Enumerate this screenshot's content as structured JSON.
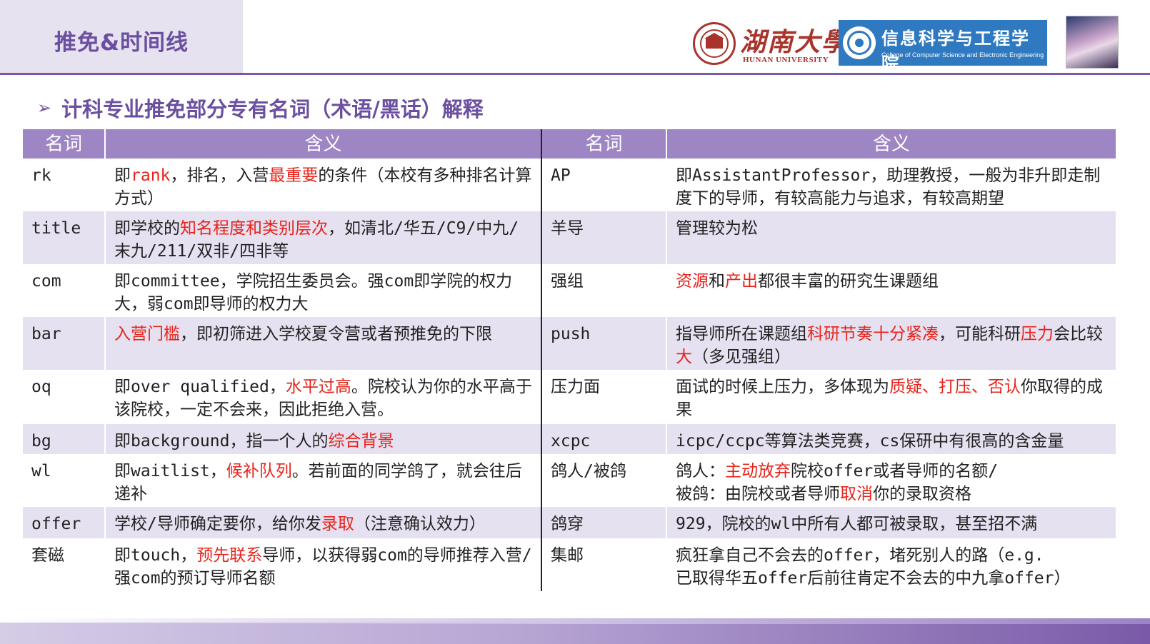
{
  "header": {
    "section_title": "推免&时间线",
    "university_cn": "湖南大學",
    "university_en": "HUNAN UNIVERSITY",
    "college_cn": "信息科学与工程学院",
    "college_en": "College of Computer Science and Electronic Engineering"
  },
  "subtitle": {
    "arrow": "➢",
    "text": "计科专业推免部分专有名词（术语/黑话）解释"
  },
  "table": {
    "headers": [
      "名词",
      "含义",
      "名词",
      "含义"
    ],
    "rows": [
      {
        "term_left": "rk",
        "left_parts": [
          {
            "t": "即",
            "red": false
          },
          {
            "t": "rank",
            "red": true
          },
          {
            "t": "，排名，入营",
            "red": false
          },
          {
            "t": "最重要",
            "red": true
          },
          {
            "t": "的条件（本校有多种排名计算方式）",
            "red": false
          }
        ],
        "term_right": "AP",
        "right_parts": [
          {
            "t": "即AssistantProfessor，助理教授，一般为非升即走制度下的导师，有较高能力与追求，有较高期望",
            "red": false
          }
        ]
      },
      {
        "term_left": "title",
        "left_parts": [
          {
            "t": "即学校的",
            "red": false
          },
          {
            "t": "知名程度和类别层次",
            "red": true
          },
          {
            "t": "，如清北/华五/C9/中九/末九/211/双非/四非等",
            "red": false
          }
        ],
        "term_right": "羊导",
        "right_parts": [
          {
            "t": "管理较为松",
            "red": false
          }
        ]
      },
      {
        "term_left": "com",
        "left_parts": [
          {
            "t": "即committee，学院招生委员会。强com即学院的权力大，弱com即导师的权力大",
            "red": false
          }
        ],
        "term_right": "强组",
        "right_parts": [
          {
            "t": "资源",
            "red": true
          },
          {
            "t": "和",
            "red": false
          },
          {
            "t": "产出",
            "red": true
          },
          {
            "t": "都很丰富的研究生课题组",
            "red": false
          }
        ]
      },
      {
        "term_left": "bar",
        "left_parts": [
          {
            "t": "入营门槛",
            "red": true
          },
          {
            "t": "，即初筛进入学校夏令营或者预推免的下限",
            "red": false
          }
        ],
        "term_right": "push",
        "right_parts": [
          {
            "t": "指导师所在课题组",
            "red": false
          },
          {
            "t": "科研节奏十分紧凑",
            "red": true
          },
          {
            "t": "，可能科研",
            "red": false
          },
          {
            "t": "压力",
            "red": true
          },
          {
            "t": "会比较",
            "red": false
          },
          {
            "t": "大",
            "red": true
          },
          {
            "t": "（多见强组）",
            "red": false
          }
        ]
      },
      {
        "term_left": "oq",
        "left_parts": [
          {
            "t": "即over qualified，",
            "red": false
          },
          {
            "t": "水平过高",
            "red": true
          },
          {
            "t": "。院校认为你的水平高于该院校，一定不会来，因此拒绝入营。",
            "red": false
          }
        ],
        "term_right": "压力面",
        "right_parts": [
          {
            "t": "面试的时候上压力，多体现为",
            "red": false
          },
          {
            "t": "质疑、打压、否认",
            "red": true
          },
          {
            "t": "你取得的成果",
            "red": false
          }
        ]
      },
      {
        "term_left": "bg",
        "left_parts": [
          {
            "t": "即background，指一个人的",
            "red": false
          },
          {
            "t": "综合背景",
            "red": true
          }
        ],
        "term_right": "xcpc",
        "right_parts": [
          {
            "t": "icpc/ccpc等算法类竞赛，cs保研中有很高的含金量",
            "red": false
          }
        ]
      },
      {
        "term_left": "wl",
        "left_parts": [
          {
            "t": "即waitlist，",
            "red": false
          },
          {
            "t": "候补队列",
            "red": true
          },
          {
            "t": "。若前面的同学鸽了，就会往后递补",
            "red": false
          }
        ],
        "term_right": "鸽人/被鸽",
        "right_parts": [
          {
            "t": "鸽人：",
            "red": false
          },
          {
            "t": "主动放弃",
            "red": true
          },
          {
            "t": "院校offer或者导师的名额/",
            "red": false
          },
          {
            "t": "\n",
            "red": false
          },
          {
            "t": "被鸽：由院校或者导师",
            "red": false
          },
          {
            "t": "取消",
            "red": true
          },
          {
            "t": "你的录取资格",
            "red": false
          }
        ]
      },
      {
        "term_left": "offer",
        "left_parts": [
          {
            "t": "学校/导师确定要你，给你发",
            "red": false
          },
          {
            "t": "录取",
            "red": true
          },
          {
            "t": "（注意确认效力）",
            "red": false
          }
        ],
        "term_right": "鸽穿",
        "right_parts": [
          {
            "t": "929，院校的wl中所有人都可被录取，甚至招不满",
            "red": false
          }
        ]
      },
      {
        "term_left": "套磁",
        "left_parts": [
          {
            "t": "即touch，",
            "red": false
          },
          {
            "t": "预先联系",
            "red": true
          },
          {
            "t": "导师，以获得弱com的导师推荐入营/强com的预订导师名额",
            "red": false
          }
        ],
        "term_right": "集邮",
        "right_parts": [
          {
            "t": "疯狂拿自己不会去的offer，堵死别人的路（e.g.",
            "red": false
          },
          {
            "t": "\n",
            "red": false
          },
          {
            "t": "已取得华五offer后前往肯定不会去的中九拿offer）",
            "red": false
          }
        ]
      }
    ]
  },
  "colors": {
    "accent": "#6b4fa0",
    "header_bg": "#9e86c4",
    "alt_row": "#e6e1f0",
    "highlight": "#e8231b",
    "hnu_red": "#a8342c",
    "college_blue": "#2e79c0"
  }
}
